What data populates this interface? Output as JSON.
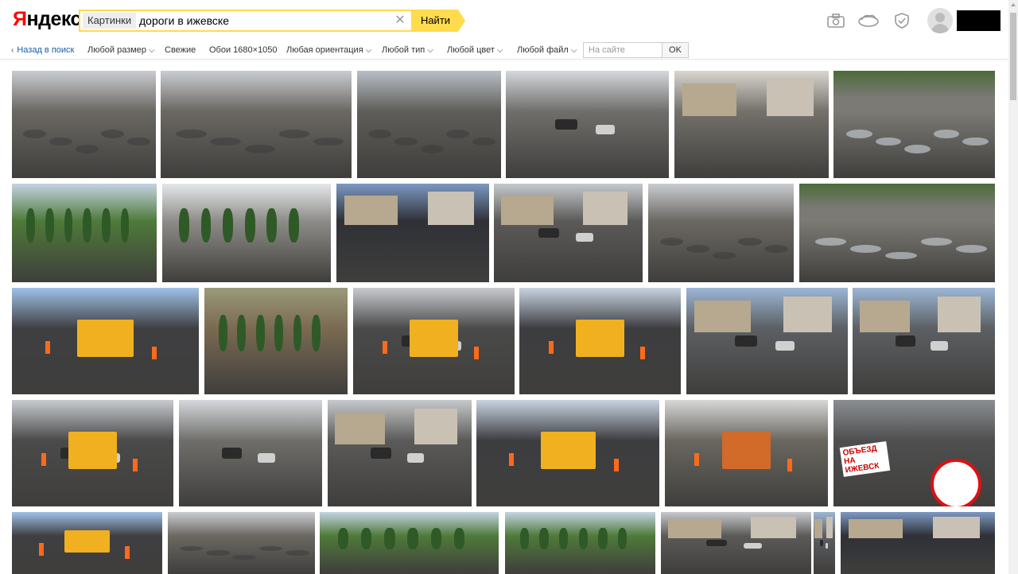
{
  "header": {
    "logo_text_first": "Я",
    "logo_text_rest": "ндекс",
    "search_chip": "Картинки",
    "search_query": "дороги в ижевске",
    "search_button": "Найти",
    "icons": [
      "camera-icon",
      "cloud-icon",
      "shield-icon",
      "user-avatar"
    ]
  },
  "filters": {
    "back": "Назад в поиск",
    "items": [
      {
        "label": "Любой размер",
        "has_chevron": true
      },
      {
        "label": "Свежие",
        "has_chevron": false
      },
      {
        "label": "Обои 1680×1050",
        "has_chevron": false
      },
      {
        "label": "Любая ориентация",
        "has_chevron": true
      },
      {
        "label": "Любой тип",
        "has_chevron": true
      },
      {
        "label": "Любой цвет",
        "has_chevron": true
      },
      {
        "label": "Любой файл",
        "has_chevron": true
      }
    ],
    "site_placeholder": "На сайте",
    "ok_label": "OK"
  },
  "colors": {
    "accent_yellow": "#ffdb4d",
    "logo_red": "#ff0000",
    "link_blue": "#1a5dab"
  },
  "grid": {
    "rows": [
      {
        "count": 6
      },
      {
        "count": 6
      },
      {
        "count": 6
      },
      {
        "count": 6
      },
      {
        "count": 7
      }
    ],
    "signs": {
      "detour": "ОБЪЕЗД НА ИЖЕВСК"
    }
  }
}
